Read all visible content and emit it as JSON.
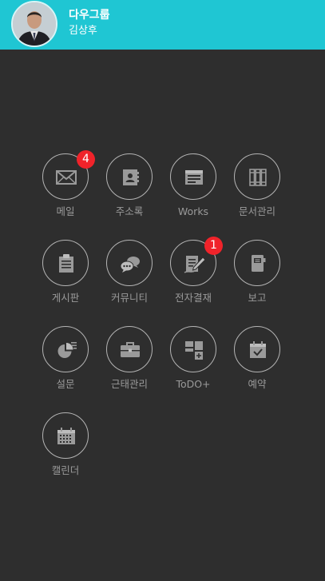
{
  "header": {
    "company": "다우그룹",
    "user_name": "김상후",
    "background": "#1fc6d3"
  },
  "menu": [
    {
      "id": "mail",
      "label": "메일",
      "icon": "envelope-icon",
      "badge": "4"
    },
    {
      "id": "address-book",
      "label": "주소록",
      "icon": "contact-card-icon"
    },
    {
      "id": "works",
      "label": "Works",
      "icon": "works-card-icon"
    },
    {
      "id": "document-management",
      "label": "문서관리",
      "icon": "binders-icon"
    },
    {
      "id": "board",
      "label": "게시판",
      "icon": "clipboard-icon"
    },
    {
      "id": "community",
      "label": "커뮤니티",
      "icon": "chat-bubbles-icon"
    },
    {
      "id": "approval",
      "label": "전자결재",
      "icon": "document-pen-icon",
      "badge": "1"
    },
    {
      "id": "report",
      "label": "보고",
      "icon": "notebook-icon"
    },
    {
      "id": "survey",
      "label": "설문",
      "icon": "pie-chart-icon"
    },
    {
      "id": "attendance",
      "label": "근태관리",
      "icon": "briefcase-icon"
    },
    {
      "id": "todo",
      "label": "ToDO+",
      "icon": "todo-board-icon"
    },
    {
      "id": "reservation",
      "label": "예약",
      "icon": "calendar-check-icon"
    },
    {
      "id": "calendar",
      "label": "캘린더",
      "icon": "calendar-grid-icon"
    }
  ],
  "colors": {
    "background": "#2e2e2e",
    "icon_border": "#b4b4b4",
    "icon_fill": "#9a9a9a",
    "label": "#9a9a9a",
    "badge": "#f0232a"
  }
}
